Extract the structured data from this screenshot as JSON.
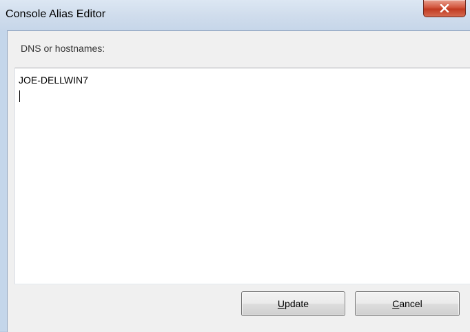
{
  "window": {
    "title": "Console Alias Editor",
    "close_icon": "close-icon"
  },
  "form": {
    "label": "DNS or hostnames:",
    "hostnames_value": "JOE-DELLWIN7"
  },
  "buttons": {
    "update": {
      "mnemonic": "U",
      "rest": "pdate",
      "label": "Update"
    },
    "cancel": {
      "mnemonic": "C",
      "rest": "ancel",
      "label": "Cancel"
    }
  },
  "colors": {
    "close_button": "#c94a33",
    "client_background": "#f0f0f0",
    "titlebar": "#cfdcec"
  }
}
